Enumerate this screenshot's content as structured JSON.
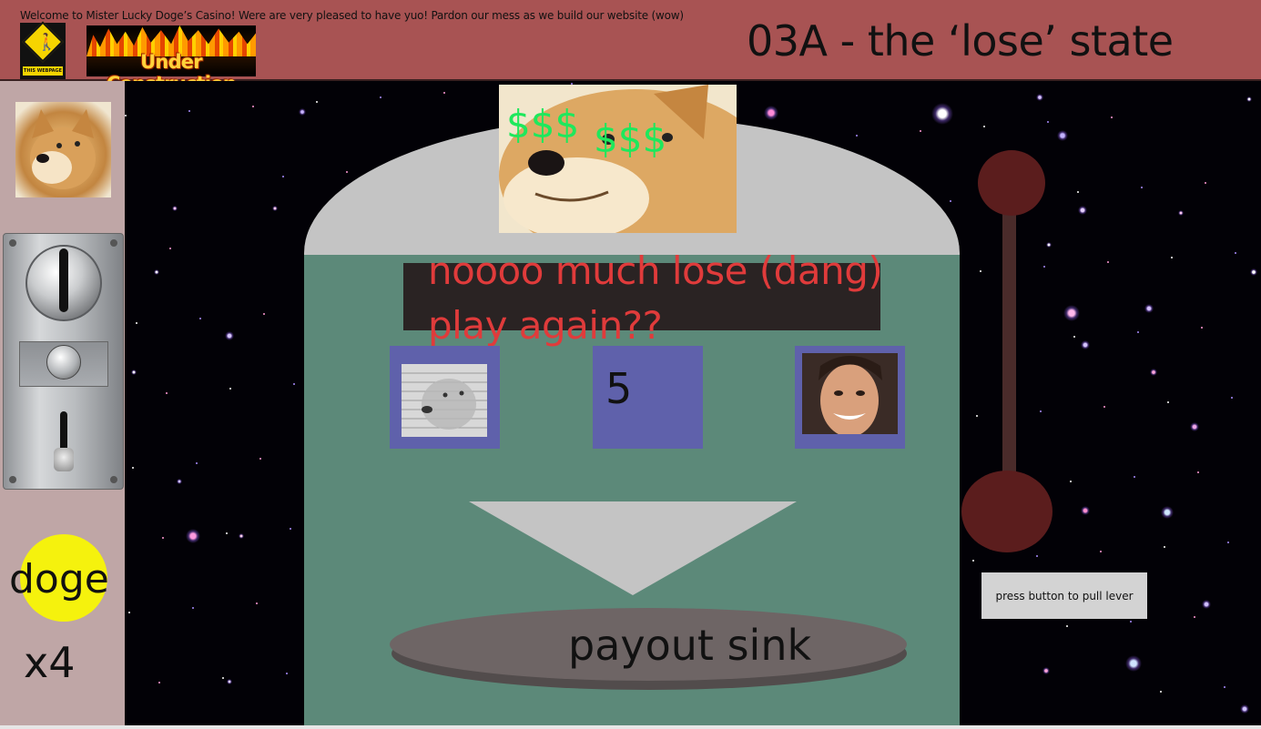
{
  "header": {
    "welcome_text": "Welcome to Mister Lucky Doge’s Casino! Were are very pleased to have yuo! Pardon our mess as we build our website (wow)",
    "construction_sign_tag": "THIS WEBPAGE",
    "under_construction_label": "Under Construction",
    "page_title": "03A - the ‘lose’ state",
    "background_color": "#a85353"
  },
  "sidebar": {
    "avatar_icon": "doge-avatar",
    "coin_slot_icon": "coin-slot",
    "coin_label": "doge",
    "coin_count": "x4",
    "coin_color": "#f5f20d"
  },
  "machine": {
    "dollar_signs_left": "$$$",
    "dollar_signs_right": "$$$",
    "message": "noooo much lose (dang) play again??",
    "message_color": "#e03b3b",
    "reels": [
      {
        "type": "image",
        "icon": "doge-reel-image"
      },
      {
        "type": "number",
        "value": "5"
      },
      {
        "type": "image",
        "icon": "nicolas-cage-face"
      }
    ],
    "payout_sink_label": "payout sink",
    "body_color": "#5c8979",
    "dome_color": "#c4c4c4",
    "reel_color": "#5f61ab"
  },
  "lever": {
    "button_label": "press button to pull lever",
    "lever_color": "#5b1d1d"
  }
}
